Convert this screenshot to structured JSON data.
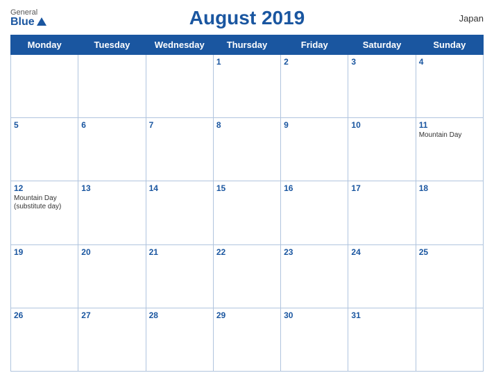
{
  "header": {
    "logo_general": "General",
    "logo_blue": "Blue",
    "title": "August 2019",
    "country": "Japan"
  },
  "days_of_week": [
    "Monday",
    "Tuesday",
    "Wednesday",
    "Thursday",
    "Friday",
    "Saturday",
    "Sunday"
  ],
  "weeks": [
    [
      {
        "day": "",
        "holiday": ""
      },
      {
        "day": "",
        "holiday": ""
      },
      {
        "day": "",
        "holiday": ""
      },
      {
        "day": "1",
        "holiday": ""
      },
      {
        "day": "2",
        "holiday": ""
      },
      {
        "day": "3",
        "holiday": ""
      },
      {
        "day": "4",
        "holiday": ""
      }
    ],
    [
      {
        "day": "5",
        "holiday": ""
      },
      {
        "day": "6",
        "holiday": ""
      },
      {
        "day": "7",
        "holiday": ""
      },
      {
        "day": "8",
        "holiday": ""
      },
      {
        "day": "9",
        "holiday": ""
      },
      {
        "day": "10",
        "holiday": ""
      },
      {
        "day": "11",
        "holiday": "Mountain Day"
      }
    ],
    [
      {
        "day": "12",
        "holiday": "Mountain Day (substitute day)"
      },
      {
        "day": "13",
        "holiday": ""
      },
      {
        "day": "14",
        "holiday": ""
      },
      {
        "day": "15",
        "holiday": ""
      },
      {
        "day": "16",
        "holiday": ""
      },
      {
        "day": "17",
        "holiday": ""
      },
      {
        "day": "18",
        "holiday": ""
      }
    ],
    [
      {
        "day": "19",
        "holiday": ""
      },
      {
        "day": "20",
        "holiday": ""
      },
      {
        "day": "21",
        "holiday": ""
      },
      {
        "day": "22",
        "holiday": ""
      },
      {
        "day": "23",
        "holiday": ""
      },
      {
        "day": "24",
        "holiday": ""
      },
      {
        "day": "25",
        "holiday": ""
      }
    ],
    [
      {
        "day": "26",
        "holiday": ""
      },
      {
        "day": "27",
        "holiday": ""
      },
      {
        "day": "28",
        "holiday": ""
      },
      {
        "day": "29",
        "holiday": ""
      },
      {
        "day": "30",
        "holiday": ""
      },
      {
        "day": "31",
        "holiday": ""
      },
      {
        "day": "",
        "holiday": ""
      }
    ]
  ]
}
